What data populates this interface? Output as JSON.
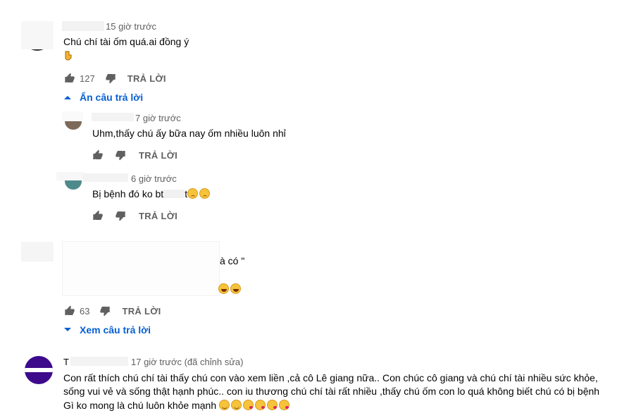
{
  "comments": [
    {
      "time": "15 giờ trước",
      "text": "Chú chí tài ốm quá.ai đồng ý",
      "likes": "127",
      "reply_label": "TRẢ LỜI",
      "toggle_label": "Ẩn câu trả lời",
      "emoji_line": "point-down-emoji"
    },
    {
      "time": "7 giờ trước",
      "text": "Uhm,thấy chú ấy bữa nay ốm nhiều luôn nhỉ",
      "reply_label": "TRẢ LỜI"
    },
    {
      "time": "6 giờ trước",
      "text": "Bị bệnh đó ko bt",
      "text_tail": "t",
      "reply_label": "TRẢ LỜI"
    },
    {
      "text_fragment": "à có \"",
      "likes": "63",
      "reply_label": "TRẢ LỜI",
      "toggle_label": "Xem câu trả lời"
    },
    {
      "author_initial": "T",
      "time": "17 giờ trước (đã chỉnh sửa)",
      "line1": "Con rất thích chú chí tài thấy chú con vào xem liền ,cả cô Lê giang nữa.. Con chúc cô giang và chú chí tài nhiều sức khỏe,",
      "line2": "sống vui vẻ và sống thật hạnh phúc.. con iu thương chú chí tài rất nhiều ,thấy chú ốm con lo quá không biết chú có bị bệnh",
      "line3": "Gì ko mong là chú luôn khỏe mạnh"
    }
  ],
  "colors": {
    "accent": "#065fd4",
    "meta": "#606060",
    "text": "#030303",
    "avatar_purple": "#3d0a8c"
  }
}
